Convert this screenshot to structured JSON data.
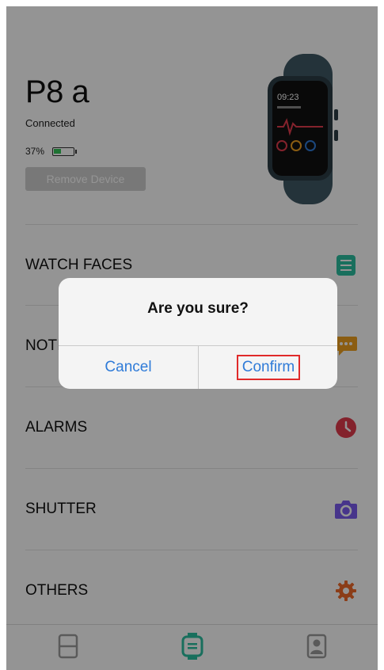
{
  "device": {
    "name": "P8 a",
    "status": "Connected",
    "battery_percent_label": "37%",
    "battery_level": 0.37,
    "remove_button": "Remove Device",
    "watch_time": "09:23"
  },
  "menu": [
    {
      "label": "WATCH FACES",
      "icon": "watch-face-icon",
      "color": "#2bbfa0"
    },
    {
      "label": "NOTIFICATIONS",
      "icon": "chat-bubble-icon",
      "color": "#f0a01f"
    },
    {
      "label": "ALARMS",
      "icon": "clock-icon",
      "color": "#e23b4d"
    },
    {
      "label": "SHUTTER",
      "icon": "camera-icon",
      "color": "#7b5cf0"
    },
    {
      "label": "OTHERS",
      "icon": "gear-icon",
      "color": "#ef6a2a"
    }
  ],
  "tabs": [
    {
      "name": "tab-home",
      "icon": "layout-icon",
      "active": false
    },
    {
      "name": "tab-device",
      "icon": "watch-icon",
      "active": true
    },
    {
      "name": "tab-profile",
      "icon": "user-icon",
      "active": false
    }
  ],
  "dialog": {
    "title": "Are you sure?",
    "cancel": "Cancel",
    "confirm": "Confirm"
  },
  "colors": {
    "accent_blue": "#2f7bd8",
    "active_tab": "#2bbfa0",
    "inactive_tab": "#9b9b9b",
    "highlight_box": "#e02a2a"
  }
}
